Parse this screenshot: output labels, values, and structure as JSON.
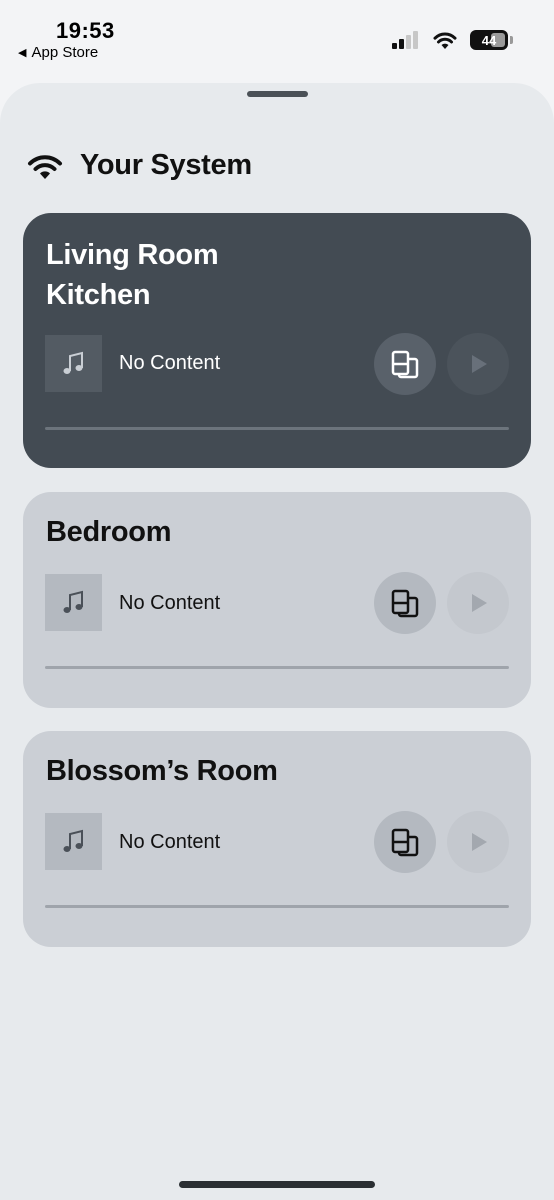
{
  "status_bar": {
    "time": "19:53",
    "back_label": "App Store",
    "battery": "44"
  },
  "header": {
    "title": "Your System",
    "icon": "wifi-icon"
  },
  "rooms": [
    {
      "names": [
        "Living Room",
        "Kitchen"
      ],
      "content": "No Content",
      "selected": true
    },
    {
      "names": [
        "Bedroom"
      ],
      "content": "No Content",
      "selected": false
    },
    {
      "names": [
        "Blossom’s Room"
      ],
      "content": "No Content",
      "selected": false
    }
  ],
  "icons": {
    "art": "music-note-icon",
    "group": "speaker-group-icon",
    "play": "play-icon"
  },
  "colors": {
    "selected_card": "#434b53",
    "card": "#cbcfd5",
    "sheet": "#e7eaed"
  }
}
